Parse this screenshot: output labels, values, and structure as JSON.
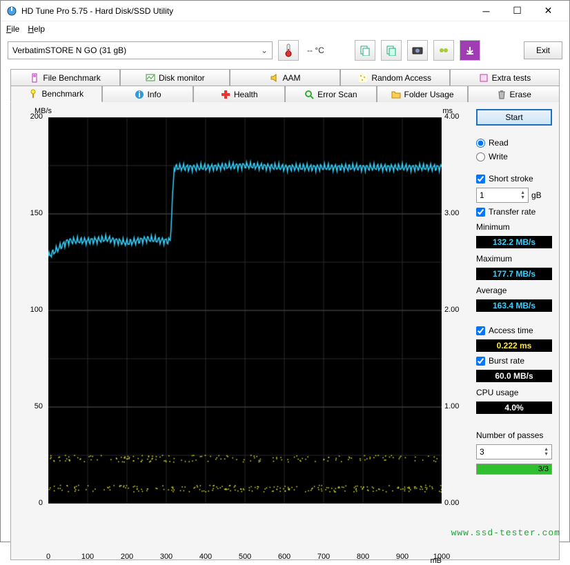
{
  "window": {
    "title": "HD Tune Pro 5.75 - Hard Disk/SSD Utility"
  },
  "menu": {
    "file": "File",
    "help": "Help"
  },
  "toolbar": {
    "drive": "VerbatimSTORE N GO (31 gB)",
    "temp": "-- °C",
    "exit": "Exit"
  },
  "tabs_top": [
    "File Benchmark",
    "Disk monitor",
    "AAM",
    "Random Access",
    "Extra tests"
  ],
  "tabs_bottom": [
    "Benchmark",
    "Info",
    "Health",
    "Error Scan",
    "Folder Usage",
    "Erase"
  ],
  "active_tab": "Benchmark",
  "side": {
    "start": "Start",
    "read": "Read",
    "write": "Write",
    "short_stroke": "Short stroke",
    "short_stroke_value": "1",
    "short_stroke_unit": "gB",
    "transfer_rate": "Transfer rate",
    "minimum_label": "Minimum",
    "minimum": "132.2 MB/s",
    "maximum_label": "Maximum",
    "maximum": "177.7 MB/s",
    "average_label": "Average",
    "average": "163.4 MB/s",
    "access_time_label": "Access time",
    "access_time": "0.222 ms",
    "burst_rate_label": "Burst rate",
    "burst_rate": "60.0 MB/s",
    "cpu_label": "CPU usage",
    "cpu": "4.0%",
    "passes_label": "Number of passes",
    "passes": "3",
    "passes_progress": "3/3"
  },
  "watermark": "www.ssd-tester.com",
  "chart_data": {
    "type": "line",
    "left_axis_label": "MB/s",
    "right_axis_label": "ms",
    "xlabel": "mB",
    "x_range": [
      0,
      1000
    ],
    "x_ticks": [
      0,
      100,
      200,
      300,
      400,
      500,
      600,
      700,
      800,
      900,
      1000
    ],
    "y_left_range": [
      0,
      200
    ],
    "y_left_ticks": [
      0,
      50,
      100,
      150,
      200
    ],
    "y_right_range": [
      0,
      4.0
    ],
    "y_right_ticks": [
      0,
      1.0,
      2.0,
      3.0,
      4.0
    ],
    "series": [
      {
        "name": "Transfer rate",
        "axis": "left",
        "color": "#34d3ff",
        "x": [
          0,
          50,
          100,
          150,
          200,
          250,
          300,
          310,
          320,
          350,
          400,
          500,
          600,
          700,
          800,
          900,
          1000
        ],
        "y": [
          128,
          136,
          136,
          137,
          135,
          137,
          136,
          136,
          174,
          174,
          174,
          175,
          174,
          174,
          174,
          174,
          174
        ]
      },
      {
        "name": "Access time lower",
        "axis": "right",
        "color": "#e8e82a",
        "style": "scatter",
        "y_approx": 0.16,
        "count": 220
      },
      {
        "name": "Access time upper",
        "axis": "right",
        "color": "#e8e82a",
        "style": "scatter",
        "y_approx": 0.47,
        "count": 160
      }
    ]
  }
}
